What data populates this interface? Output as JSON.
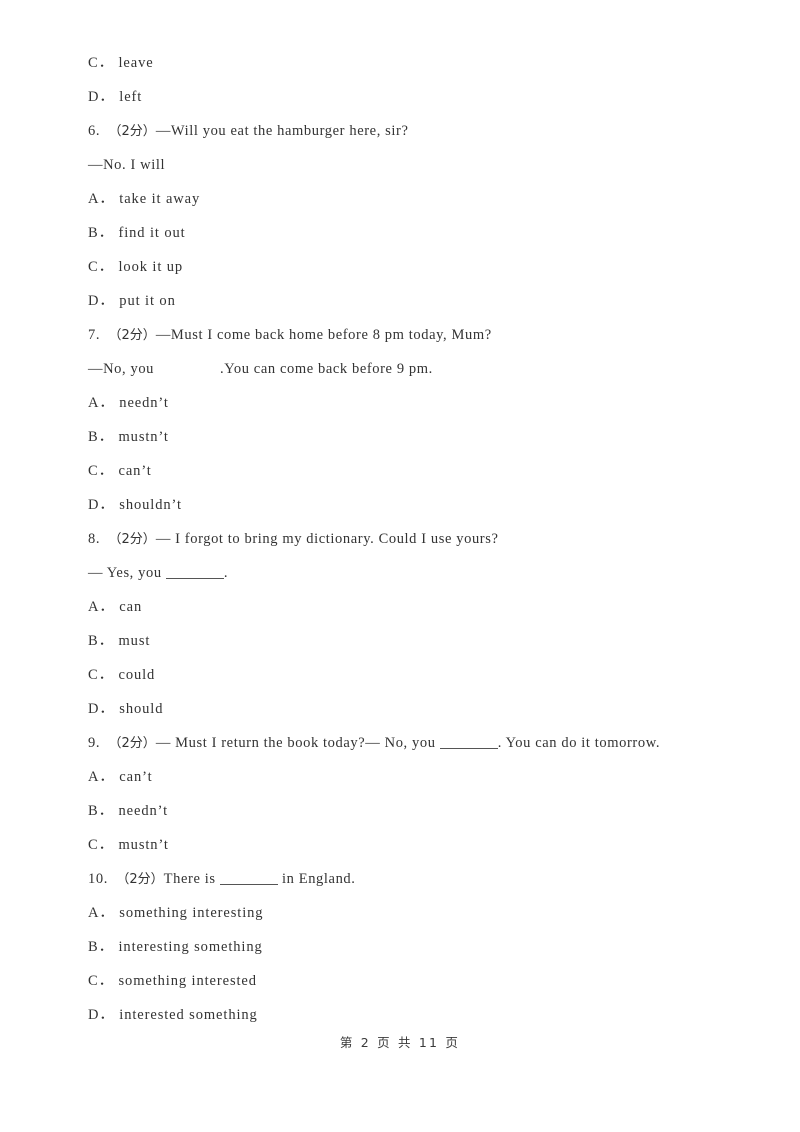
{
  "document": {
    "page_footer": "第 2 页 共 11 页",
    "score_tag": "（2分）"
  },
  "lines": [
    {
      "id": "l01",
      "kind": "option",
      "text": "C． leave"
    },
    {
      "id": "l02",
      "kind": "option",
      "text": "D． left"
    },
    {
      "id": "l03",
      "kind": "question",
      "number": "6.",
      "score": "（2分）",
      "text": "—Will you eat the hamburger here, sir?"
    },
    {
      "id": "l04",
      "kind": "question-cont",
      "text": "—No. I will"
    },
    {
      "id": "l05",
      "kind": "option",
      "text": "A． take it away"
    },
    {
      "id": "l06",
      "kind": "option",
      "text": "B． find it out"
    },
    {
      "id": "l07",
      "kind": "option",
      "text": "C． look it up"
    },
    {
      "id": "l08",
      "kind": "option",
      "text": "D． put it on"
    },
    {
      "id": "l09",
      "kind": "question",
      "number": "7.",
      "score": "（2分）",
      "text": "—Must I come back home before 8 pm today, Mum?"
    },
    {
      "id": "l10",
      "kind": "question-cont-gap",
      "prefix": "—No, you",
      "suffix": ".You can come back before 9 pm."
    },
    {
      "id": "l11",
      "kind": "option",
      "text": "A． needn’t"
    },
    {
      "id": "l12",
      "kind": "option",
      "text": "B． mustn’t"
    },
    {
      "id": "l13",
      "kind": "option",
      "text": "C． can’t"
    },
    {
      "id": "l14",
      "kind": "option",
      "text": "D． shouldn’t"
    },
    {
      "id": "l15",
      "kind": "question",
      "number": "8.",
      "score": "（2分）",
      "text": "— I forgot to bring my dictionary. Could I use yours?"
    },
    {
      "id": "l16",
      "kind": "question-cont-blank",
      "prefix": "— Yes, you ",
      "suffix": "."
    },
    {
      "id": "l17",
      "kind": "option",
      "text": "A． can"
    },
    {
      "id": "l18",
      "kind": "option",
      "text": "B． must"
    },
    {
      "id": "l19",
      "kind": "option",
      "text": "C． could"
    },
    {
      "id": "l20",
      "kind": "option",
      "text": "D． should"
    },
    {
      "id": "l21",
      "kind": "question-blank",
      "number": "9.",
      "score": "（2分）",
      "prefix": "— Must I return the book today?— No, you ",
      "suffix": ". You can do it tomorrow."
    },
    {
      "id": "l22",
      "kind": "option",
      "text": "A． can’t"
    },
    {
      "id": "l23",
      "kind": "option",
      "text": "B． needn’t"
    },
    {
      "id": "l24",
      "kind": "option",
      "text": "C． mustn’t"
    },
    {
      "id": "l25",
      "kind": "question-blank",
      "number": "10.",
      "score": "（2分）",
      "prefix": "There is ",
      "suffix": " in England."
    },
    {
      "id": "l26",
      "kind": "option",
      "text": "A． something interesting"
    },
    {
      "id": "l27",
      "kind": "option",
      "text": "B． interesting something"
    },
    {
      "id": "l28",
      "kind": "option",
      "text": "C． something interested"
    },
    {
      "id": "l29",
      "kind": "option",
      "text": "D． interested something"
    }
  ]
}
